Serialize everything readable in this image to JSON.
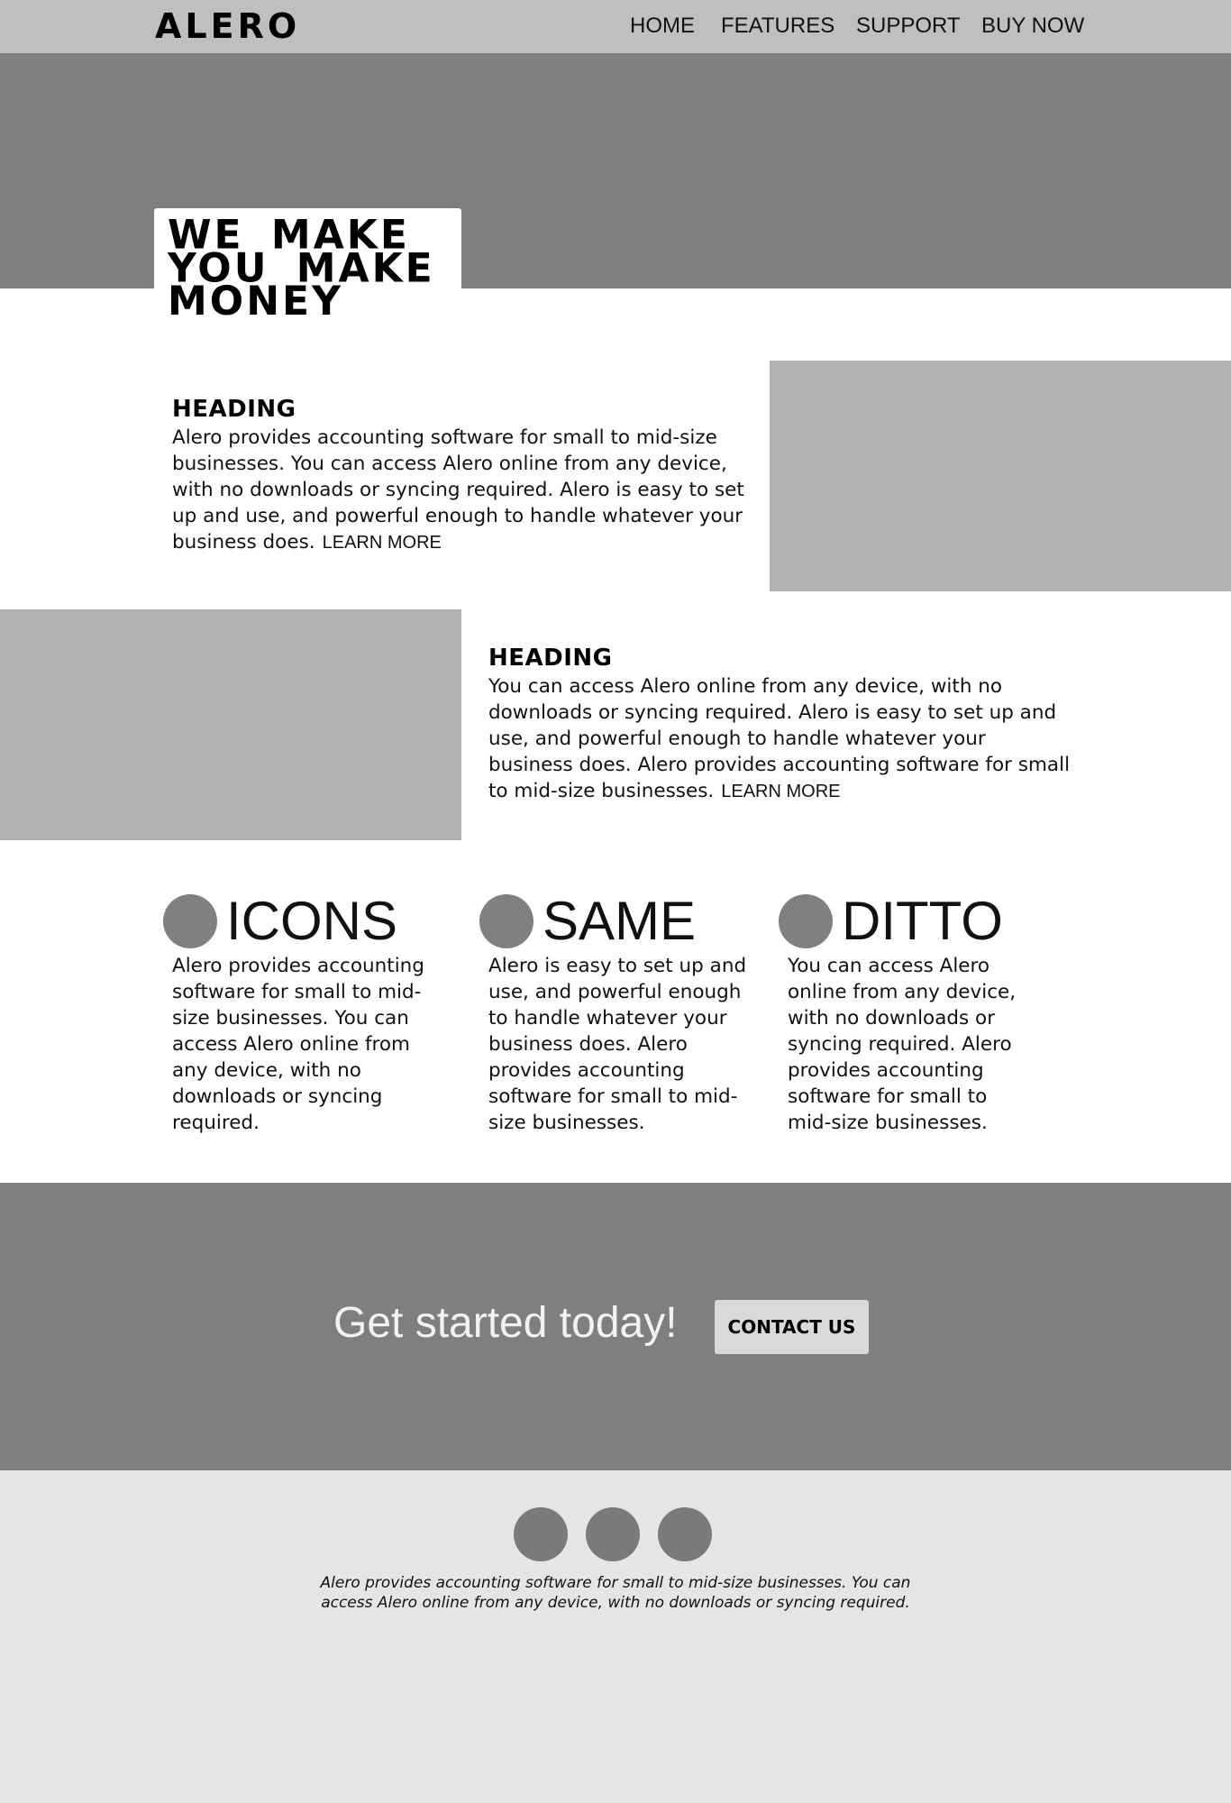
{
  "nav": {
    "brand": "ALERO",
    "links": [
      "HOME",
      "FEATURES",
      "SUPPORT",
      "BUY NOW"
    ]
  },
  "hero": {
    "title": "WE MAKE YOU MAKE MONEY"
  },
  "rows": [
    {
      "heading": "HEADING",
      "text": "Alero provides accounting software for small to mid-size businesses. You can access Alero online from any device, with no downloads or syncing required. Alero is easy to set up and use, and powerful enough to handle whatever your business does.",
      "link": "LEARN MORE"
    },
    {
      "heading": "HEADING",
      "text": "You can access Alero online from any device, with no downloads or syncing required. Alero is easy to set up and use, and powerful enough to handle whatever your business does. Alero provides accounting software for small to mid-size businesses.",
      "link": "LEARN MORE"
    }
  ],
  "features": [
    {
      "title": "ICONS",
      "text": "Alero provides accounting software for small to mid-size businesses. You can access Alero online from any device, with no downloads or syncing required."
    },
    {
      "title": "SAME",
      "text": "Alero is easy to set up and use, and powerful enough to handle whatever your business does. Alero provides accounting software for small to mid-size businesses."
    },
    {
      "title": "DITTO",
      "text": "You can access Alero online from any device, with no downloads or syncing required. Alero provides accounting software for small to mid-size businesses."
    }
  ],
  "cta": {
    "text": "Get started today!",
    "button": "CONTACT US"
  },
  "footer": {
    "text": "Alero provides accounting software for small to mid-size businesses. You can access Alero online from any device, with no downloads or syncing required."
  },
  "colors": {
    "nav_bg": "#bfbfbf",
    "hero_bg": "#7f7f7f",
    "placeholder": "#b1b1b1",
    "footer_bg": "#e5e5e5"
  }
}
